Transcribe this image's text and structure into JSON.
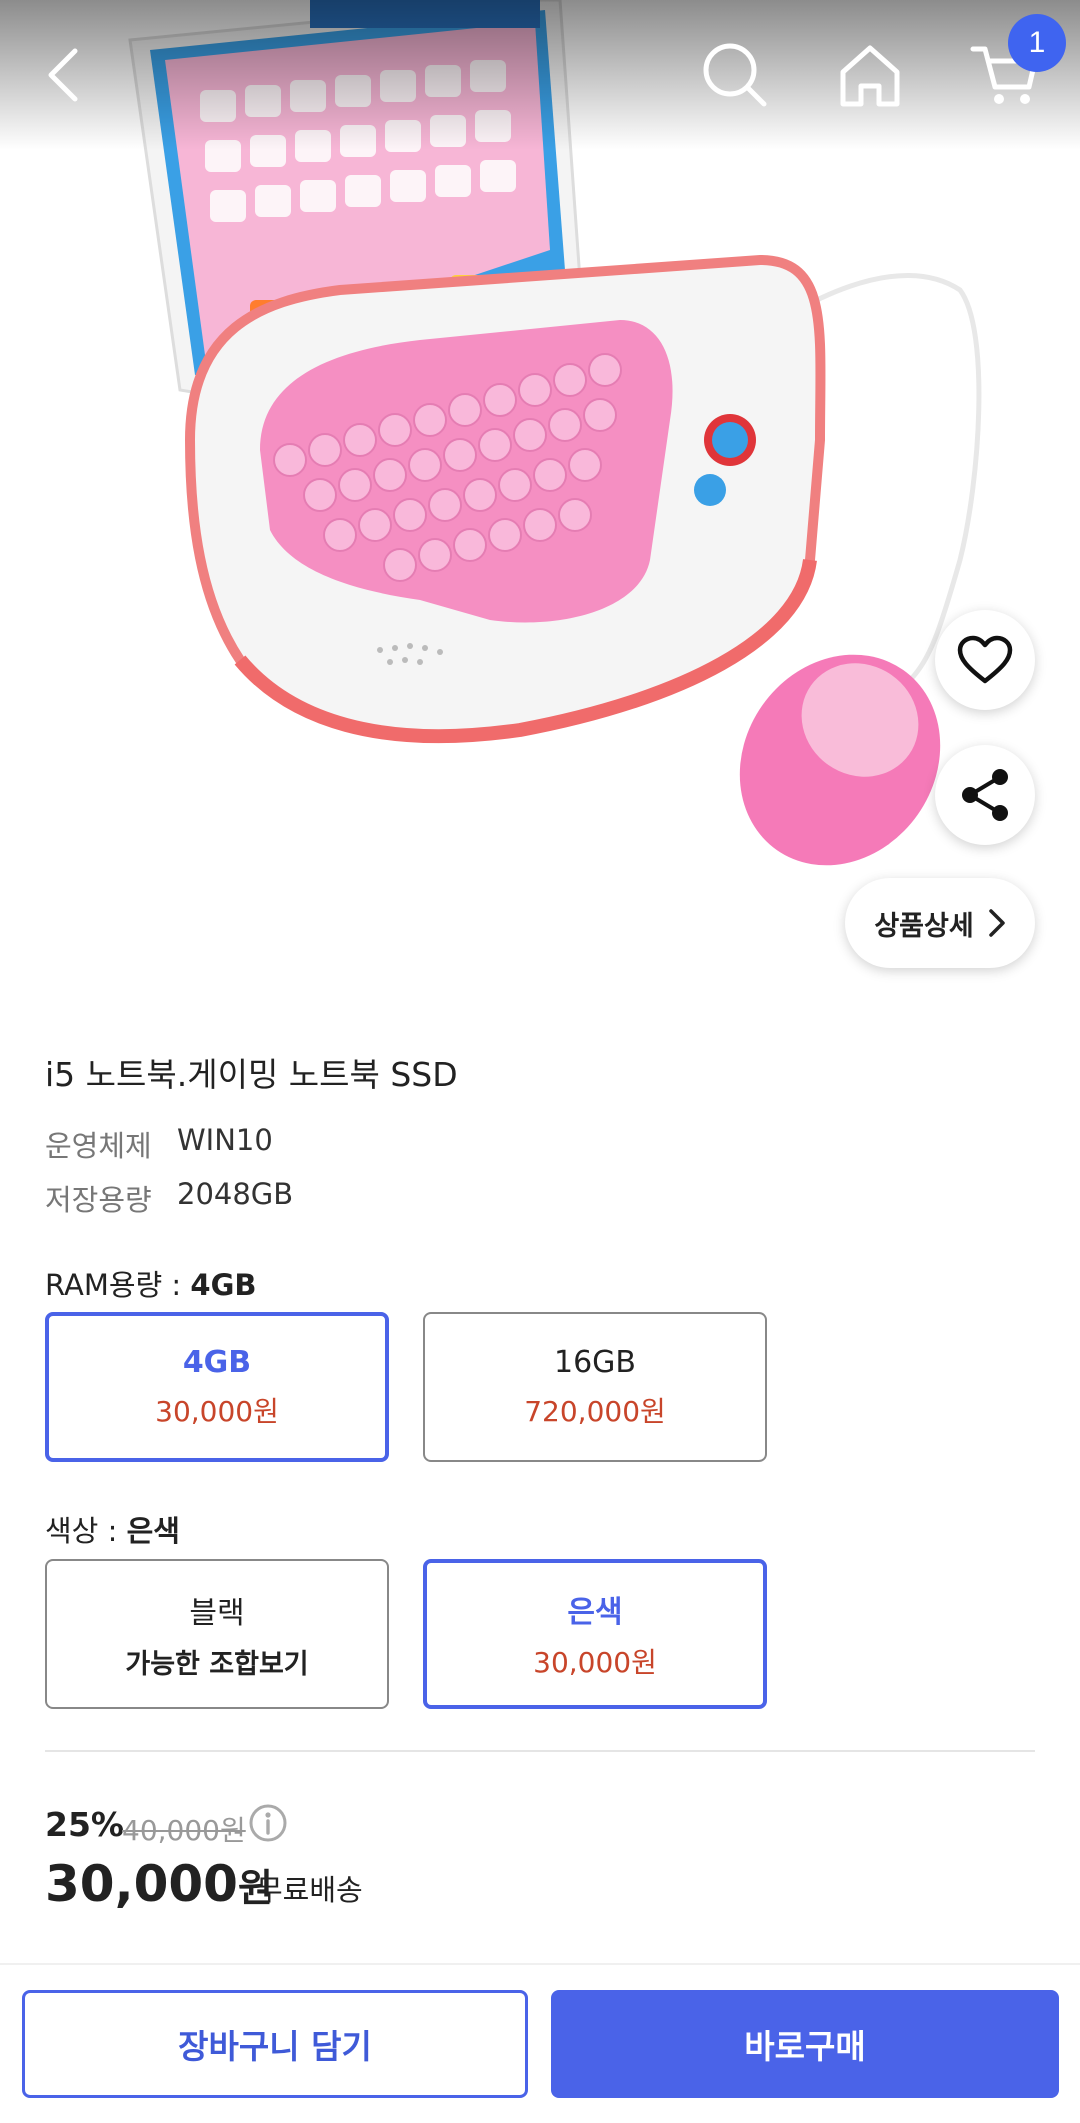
{
  "header": {
    "back_icon": "chevron-left-icon",
    "search_icon": "search-icon",
    "home_icon": "home-icon",
    "cart_icon": "cart-icon",
    "cart_count": "1"
  },
  "image_actions": {
    "wishlist_icon": "heart-icon",
    "share_icon": "share-icon",
    "detail_label": "상품상세"
  },
  "product": {
    "title": "i5 노트북.게이밍 노트북 SSD",
    "specs": [
      {
        "key": "운영체제",
        "value": "WIN10"
      },
      {
        "key": "저장용량",
        "value": "2048GB"
      }
    ]
  },
  "ram_option": {
    "label": "RAM용량 : ",
    "selected": "4GB",
    "choices": [
      {
        "name": "4GB",
        "price": "30,000원"
      },
      {
        "name": "16GB",
        "price": "720,000원"
      }
    ]
  },
  "color_option": {
    "label": "색상 : ",
    "selected": "은색",
    "choices": [
      {
        "name": "블랙",
        "note": "가능한 조합보기"
      },
      {
        "name": "은색",
        "price": "30,000원"
      }
    ]
  },
  "pricing": {
    "discount": "25%",
    "original": "40,000원",
    "final_amount": "30,000",
    "final_unit": "원",
    "shipping": "무료배송"
  },
  "actions": {
    "cart_label": "장바구니 담기",
    "buy_label": "바로구매"
  },
  "colors": {
    "accent": "#4a63e8",
    "price_red": "#c8452a"
  }
}
